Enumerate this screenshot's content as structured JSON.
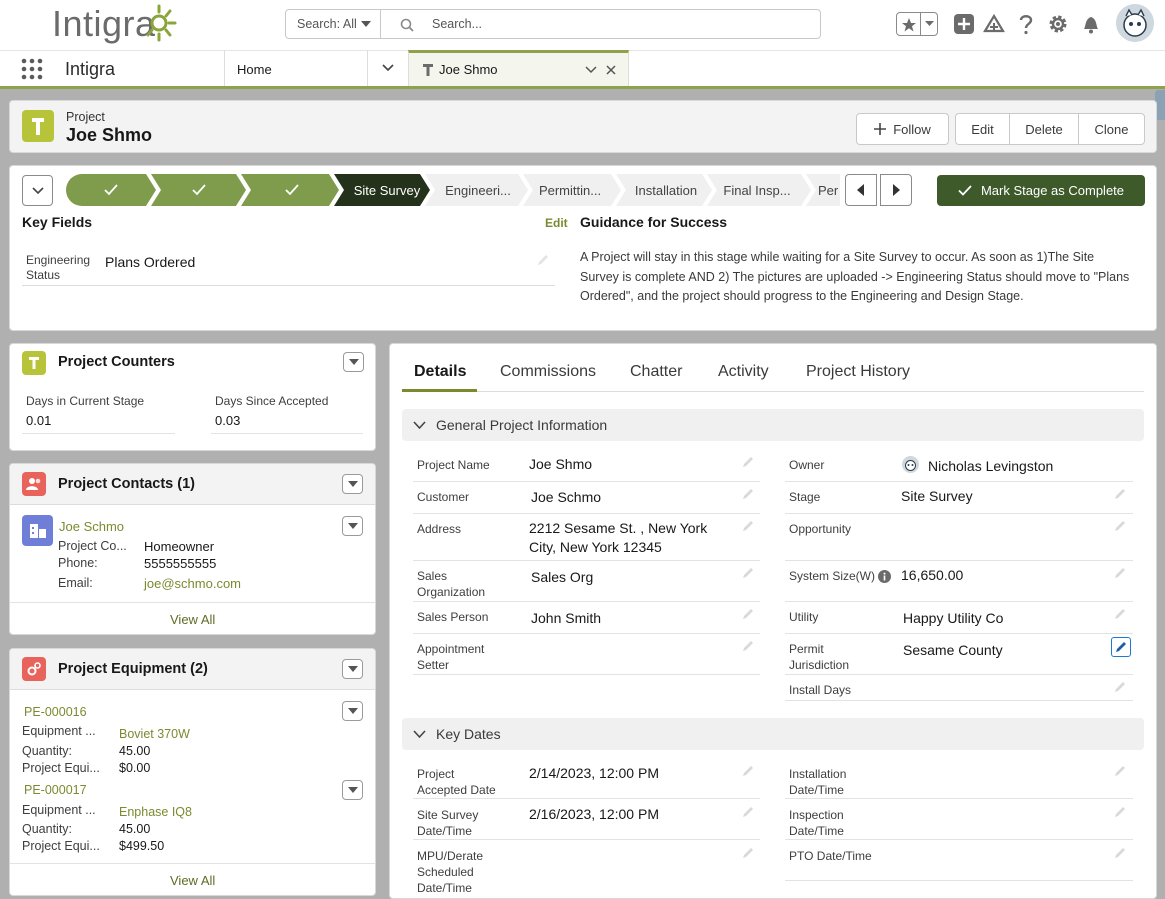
{
  "header": {
    "logo_text": "Intigra",
    "search_scope": "Search: All",
    "search_placeholder": "Search..."
  },
  "nav": {
    "app_name": "Intigra",
    "home_tab": "Home",
    "record_tab": "Joe Shmo"
  },
  "record": {
    "object_label": "Project",
    "title": "Joe Shmo",
    "actions": {
      "follow": "Follow",
      "edit": "Edit",
      "delete": "Delete",
      "clone": "Clone"
    }
  },
  "path": {
    "stages": [
      "",
      "",
      "",
      "Site Survey",
      "Engineeri...",
      "Permittin...",
      "Installation",
      "Final Insp...",
      "Per"
    ],
    "current_stage": "Site Survey",
    "mark_complete": "Mark Stage as Complete",
    "key_fields_title": "Key Fields",
    "key_fields_edit": "Edit",
    "key_field_label": "Engineering Status",
    "key_field_value": "Plans Ordered",
    "guidance_title": "Guidance for Success",
    "guidance_text": "A Project will stay in this stage while waiting for a Site Survey to occur. As soon as 1)The Site Survey is complete AND 2) The pictures are uploaded -> Engineering Status should move to \"Plans Ordered\", and the project should progress to the Engineering and Design Stage."
  },
  "counters": {
    "title": "Project Counters",
    "days_in_stage_label": "Days in Current Stage",
    "days_in_stage_value": "0.01",
    "days_since_accepted_label": "Days Since Accepted",
    "days_since_accepted_value": "0.03"
  },
  "contacts": {
    "title": "Project Contacts (1)",
    "name": "Joe Schmo",
    "role_label": "Project Co...",
    "role_value": "Homeowner",
    "phone_label": "Phone:",
    "phone_value": "5555555555",
    "email_label": "Email:",
    "email_value": "joe@schmo.com",
    "view_all": "View All"
  },
  "equipment": {
    "title": "Project Equipment (2)",
    "items": [
      {
        "id": "PE-000016",
        "equip_label": "Equipment ...",
        "equip_value": "Boviet 370W",
        "qty_label": "Quantity:",
        "qty_value": "45.00",
        "price_label": "Project Equi...",
        "price_value": "$0.00"
      },
      {
        "id": "PE-000017",
        "equip_label": "Equipment ...",
        "equip_value": "Enphase IQ8",
        "qty_label": "Quantity:",
        "qty_value": "45.00",
        "price_label": "Project Equi...",
        "price_value": "$499.50"
      }
    ],
    "view_all": "View All"
  },
  "tabs": [
    "Details",
    "Commissions",
    "Chatter",
    "Activity",
    "Project History"
  ],
  "general": {
    "title": "General Project Information",
    "left": [
      {
        "label": "Project Name",
        "value": "Joe Shmo"
      },
      {
        "label": "Customer",
        "value": "Joe Schmo"
      },
      {
        "label": "Address",
        "value": "2212 Sesame St. , New York City, New York 12345"
      },
      {
        "label": "Sales Organization",
        "value": "Sales Org"
      },
      {
        "label": "Sales Person",
        "value": "John Smith"
      },
      {
        "label": "Appointment Setter",
        "value": ""
      }
    ],
    "right": [
      {
        "label": "Owner",
        "value": "Nicholas Levingston"
      },
      {
        "label": "Stage",
        "value": "Site Survey"
      },
      {
        "label": "Opportunity",
        "value": ""
      },
      {
        "label": "System Size(W)",
        "value": "16,650.00"
      },
      {
        "label": "Utility",
        "value": "Happy Utility Co"
      },
      {
        "label": "Permit Jurisdiction",
        "value": "Sesame County"
      },
      {
        "label": "Install Days",
        "value": ""
      }
    ]
  },
  "key_dates": {
    "title": "Key Dates",
    "left": [
      {
        "label": "Project Accepted Date",
        "value": "2/14/2023, 12:00 PM"
      },
      {
        "label": "Site Survey Date/Time",
        "value": "2/16/2023, 12:00 PM"
      },
      {
        "label": "MPU/Derate Scheduled Date/Time",
        "value": ""
      }
    ],
    "right": [
      {
        "label": "Installation Date/Time",
        "value": ""
      },
      {
        "label": "Inspection Date/Time",
        "value": ""
      },
      {
        "label": "PTO Date/Time",
        "value": ""
      }
    ]
  },
  "colors": {
    "brand_green": "#8da24a",
    "complete_stage": "#7f9c4d",
    "current_stage": "#24321c",
    "mark_button": "#3e5a2a",
    "link": "#7c8a2f"
  }
}
